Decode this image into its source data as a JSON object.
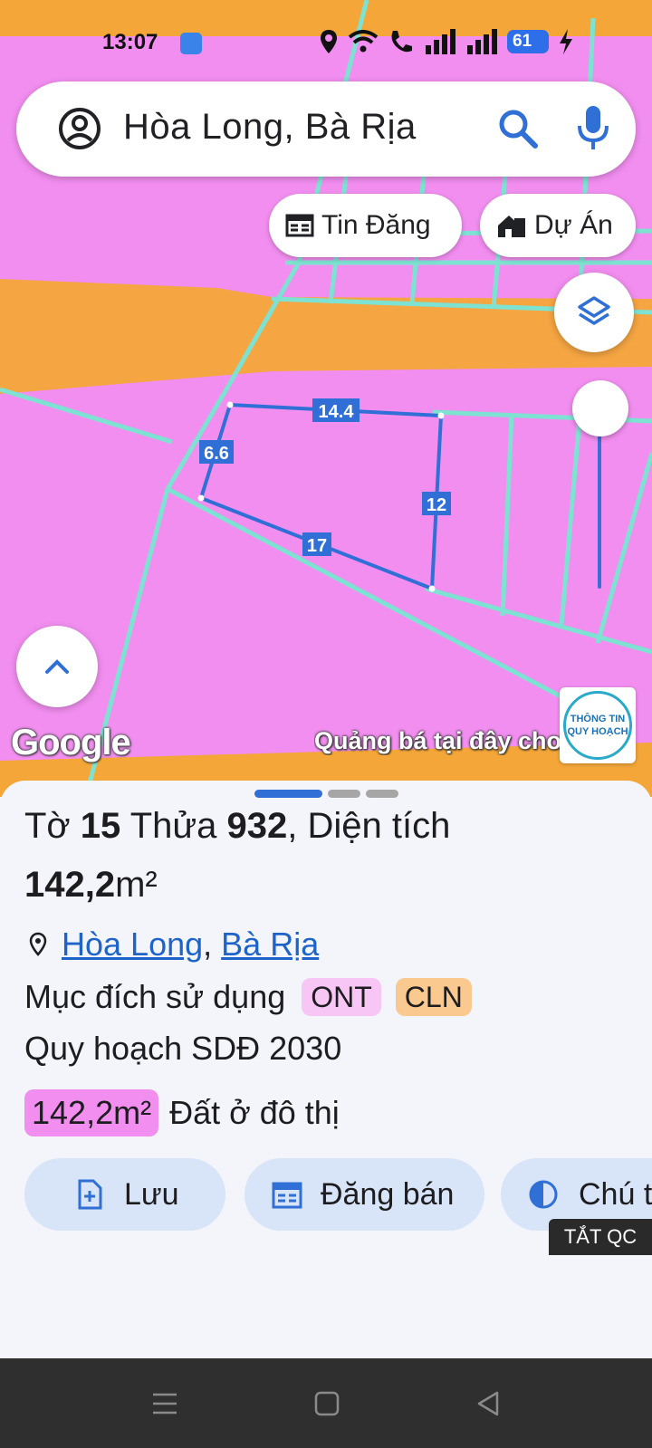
{
  "status_bar": {
    "time": "13:07",
    "battery": "61",
    "icons": [
      "home-app-icon",
      "location-icon",
      "wifi-icon",
      "volte-call-icon",
      "signal-icon",
      "signal-icon",
      "charging-icon"
    ]
  },
  "search": {
    "query": "Hòa Long, Bà Rịa",
    "icons": [
      "account-icon",
      "search-icon",
      "mic-icon"
    ]
  },
  "map_chips": [
    {
      "label": "Tin Đăng",
      "icon": "listing-icon"
    },
    {
      "label": "Dự Án",
      "icon": "project-house-icon"
    }
  ],
  "map": {
    "parcel_edges": [
      "14.4",
      "6.6",
      "12",
      "17"
    ],
    "google_label": "Google",
    "promo_text": "Quảng bá tại đây cho",
    "badge_line1": "THÔNG TIN",
    "badge_line2": "QUY HOẠCH",
    "colors": {
      "land": "#f28ef0",
      "road": "#f4a638",
      "parcel_line": "#2f6fd6",
      "plot_lines": "#7de2d1"
    }
  },
  "parcel": {
    "sheet_word": "Tờ",
    "sheet_no": "15",
    "lot_word": "Thửa",
    "lot_no": "932",
    "area_word": ", Diện tích",
    "area": "142,2",
    "area_unit": "m²",
    "location_1": "Hòa Long",
    "location_sep": ",",
    "location_2": "Bà Rịa",
    "purpose_label": "Mục đích sử dụng",
    "purpose_tags": [
      "ONT",
      "CLN"
    ],
    "plan_label": "Quy hoạch SDĐ 2030",
    "plan_area": "142,2m²",
    "plan_use": "Đất ở đô thị"
  },
  "actions": [
    {
      "label": "Lưu",
      "icon": "save-file-icon"
    },
    {
      "label": "Đăng bán",
      "icon": "calendar-post-icon"
    },
    {
      "label": "Chú t",
      "icon": "contrast-icon"
    }
  ],
  "ad_off": "TẮT QC",
  "nav_icons": [
    "recents-icon",
    "home-icon",
    "back-icon"
  ]
}
